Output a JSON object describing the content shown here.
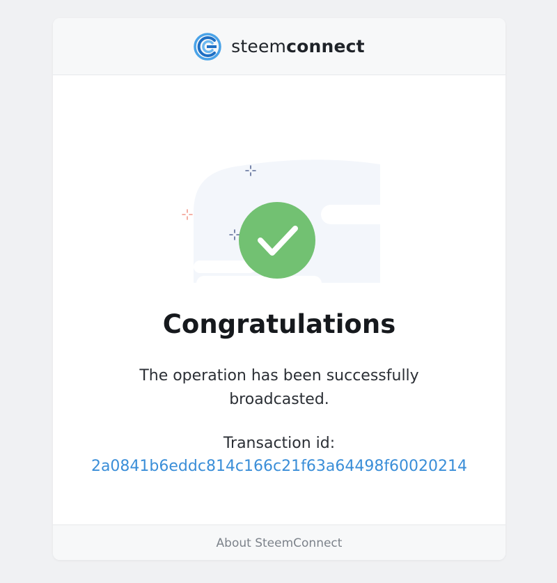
{
  "header": {
    "brand_light": "steem",
    "brand_bold": "connect",
    "logo_icon": "steemconnect-logo-icon"
  },
  "illustration": {
    "icon": "check-circle-icon",
    "accent_color": "#72c172",
    "sparkle_colors": [
      "#5a6a96",
      "#f2998a"
    ]
  },
  "main": {
    "title": "Congratulations",
    "message": "The operation has been successfully broadcasted.",
    "tx_label": "Transaction id:",
    "tx_id": "2a0841b6eddc814c166c21f63a64498f60020214"
  },
  "footer": {
    "link": "About SteemConnect"
  },
  "colors": {
    "background": "#f0f1f3",
    "card": "#ffffff",
    "link": "#3a8ed8"
  }
}
